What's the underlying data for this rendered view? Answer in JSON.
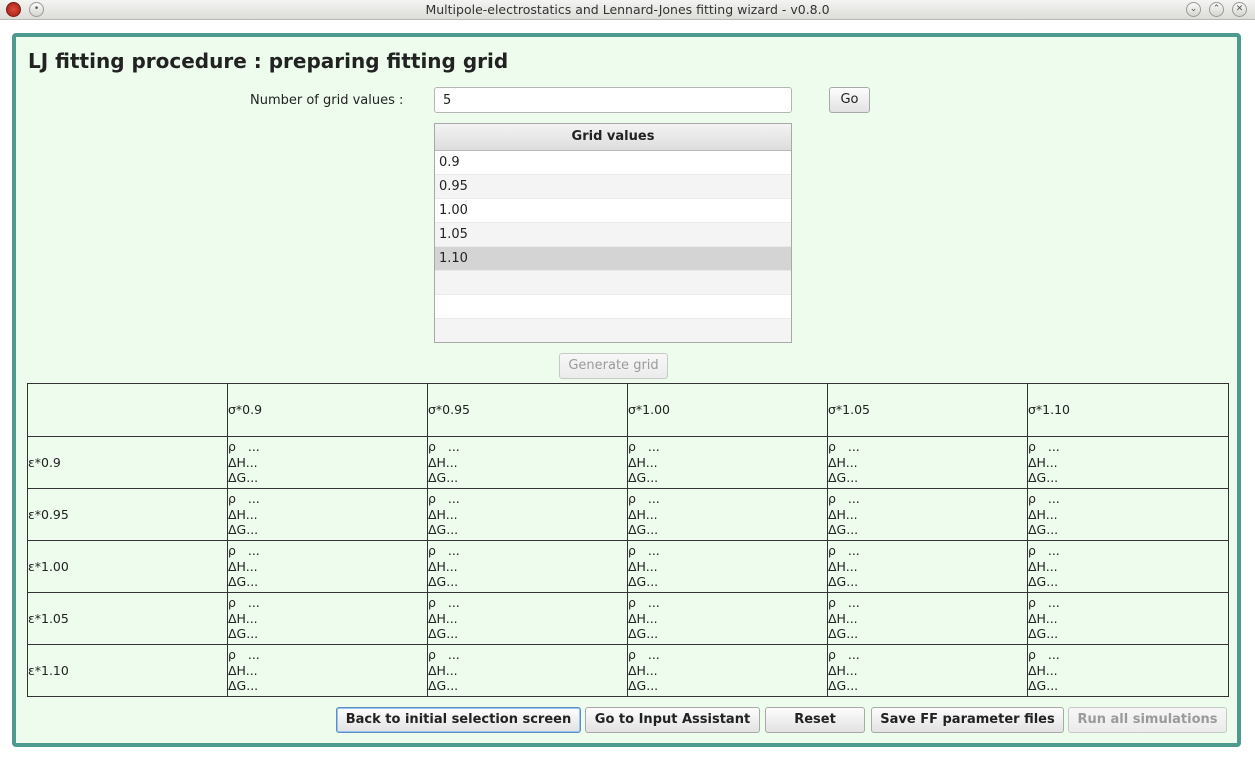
{
  "window": {
    "title": "Multipole-electrostatics and Lennard-Jones fitting wizard - v0.8.0"
  },
  "heading": "LJ fitting procedure : preparing fitting grid",
  "grid_count": {
    "label": "Number of grid values :",
    "value": "5",
    "go_label": "Go"
  },
  "grid_values": {
    "header": "Grid values",
    "rows": [
      "0.9",
      "0.95",
      "1.00",
      "1.05",
      "1.10",
      "",
      "",
      ""
    ],
    "selected_index": 4
  },
  "generate_label": "Generate grid",
  "grid_table": {
    "columns": [
      "",
      "σ*0.9",
      "σ*0.95",
      "σ*1.00",
      "σ*1.05",
      "σ*1.10"
    ],
    "rows": [
      {
        "label": "ε*0.9",
        "cells": [
          [
            "ρ   ...",
            "ΔH...",
            "ΔG..."
          ],
          [
            "ρ   ...",
            "ΔH...",
            "ΔG..."
          ],
          [
            "ρ   ...",
            "ΔH...",
            "ΔG..."
          ],
          [
            "ρ   ...",
            "ΔH...",
            "ΔG..."
          ],
          [
            "ρ   ...",
            "ΔH...",
            "ΔG..."
          ]
        ]
      },
      {
        "label": "ε*0.95",
        "cells": [
          [
            "ρ   ...",
            "ΔH...",
            "ΔG..."
          ],
          [
            "ρ   ...",
            "ΔH...",
            "ΔG..."
          ],
          [
            "ρ   ...",
            "ΔH...",
            "ΔG..."
          ],
          [
            "ρ   ...",
            "ΔH...",
            "ΔG..."
          ],
          [
            "ρ   ...",
            "ΔH...",
            "ΔG..."
          ]
        ]
      },
      {
        "label": "ε*1.00",
        "cells": [
          [
            "ρ   ...",
            "ΔH...",
            "ΔG..."
          ],
          [
            "ρ   ...",
            "ΔH...",
            "ΔG..."
          ],
          [
            "ρ   ...",
            "ΔH...",
            "ΔG..."
          ],
          [
            "ρ   ...",
            "ΔH...",
            "ΔG..."
          ],
          [
            "ρ   ...",
            "ΔH...",
            "ΔG..."
          ]
        ]
      },
      {
        "label": "ε*1.05",
        "cells": [
          [
            "ρ   ...",
            "ΔH...",
            "ΔG..."
          ],
          [
            "ρ   ...",
            "ΔH...",
            "ΔG..."
          ],
          [
            "ρ   ...",
            "ΔH...",
            "ΔG..."
          ],
          [
            "ρ   ...",
            "ΔH...",
            "ΔG..."
          ],
          [
            "ρ   ...",
            "ΔH...",
            "ΔG..."
          ]
        ]
      },
      {
        "label": "ε*1.10",
        "cells": [
          [
            "ρ   ...",
            "ΔH...",
            "ΔG..."
          ],
          [
            "ρ   ...",
            "ΔH...",
            "ΔG..."
          ],
          [
            "ρ   ...",
            "ΔH...",
            "ΔG..."
          ],
          [
            "ρ   ...",
            "ΔH...",
            "ΔG..."
          ],
          [
            "ρ   ...",
            "ΔH...",
            "ΔG..."
          ]
        ]
      }
    ]
  },
  "buttons": {
    "back": "Back to initial selection screen",
    "input_assistant": "Go to Input Assistant",
    "reset": "Reset",
    "save": "Save FF parameter files",
    "run": "Run all simulations"
  },
  "colors": {
    "panel_bg": "#eefcee",
    "frame_border": "#4f9a8f",
    "selection": "#d4d4d4"
  }
}
